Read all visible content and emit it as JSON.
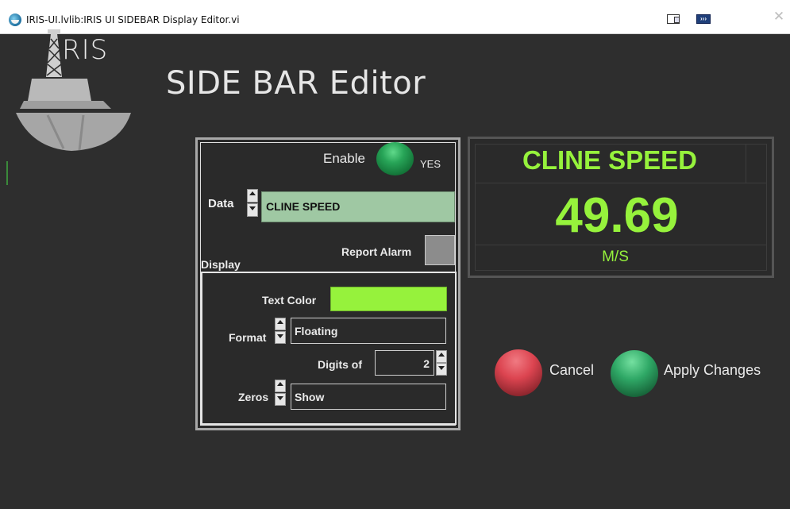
{
  "window": {
    "title": "IRIS-UI.lvlib:IRIS UI SIDEBAR Display Editor.vi",
    "app_icon": "globe-icon",
    "toolbar_icons": [
      "window-layout-icon",
      "run-arrow-icon"
    ],
    "close_glyph": "✕"
  },
  "logo": {
    "text": "RIS",
    "icon": "ship-oil-rig-logo"
  },
  "page": {
    "title": "SIDE BAR Editor"
  },
  "settings": {
    "enable_label": "Enable",
    "enable_state": "YES",
    "data_label": "Data",
    "data_value": "CLINE SPEED",
    "report_alarm_label": "Report Alarm",
    "display_label": "Display",
    "text_color_label": "Text Color",
    "text_color": "#96f23c",
    "format_label": "Format",
    "format_value": "Floating",
    "digits_label": "Digits of",
    "digits_value": "2",
    "zeros_label": "Zeros",
    "zeros_value": "Show"
  },
  "preview": {
    "name": "CLINE SPEED",
    "value": "49.69",
    "unit": "M/S",
    "color": "#96f23c"
  },
  "actions": {
    "cancel_label": "Cancel",
    "apply_label": "Apply Changes",
    "cancel_color": "#dc4450",
    "apply_color": "#2fa866"
  }
}
